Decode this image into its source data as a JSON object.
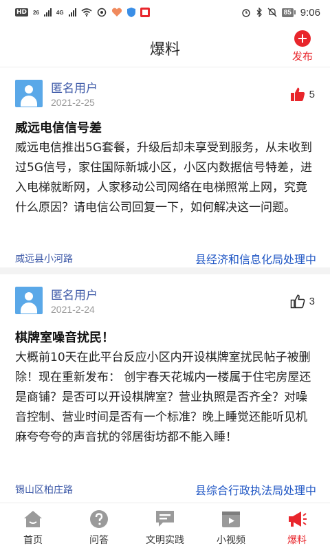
{
  "status_bar": {
    "hd": "HD",
    "sim1": "26",
    "sim2": "4G",
    "battery": "85",
    "time": "9:06"
  },
  "header": {
    "title": "爆料",
    "publish_label": "发布"
  },
  "posts": [
    {
      "user": "匿名用户",
      "date": "2021-2-25",
      "likes": "5",
      "liked": true,
      "title": "威远电信信号差",
      "body": "威远电信推出5G套餐，升级后却未享受到服务，从未收到过5G信号，家住国际新城小区，小区内数据信号特差，进入电梯就断网，人家移动公司网络在电梯照常上网，究竟什么原因？请电信公司回复一下，如何解决这一问题。",
      "location": "威远县小河路",
      "department": "县经济和信息化局处理中"
    },
    {
      "user": "匿名用户",
      "date": "2021-2-24",
      "likes": "3",
      "liked": false,
      "title": "棋牌室噪音扰民！",
      "body": "大概前10天在此平台反应小区内开设棋牌室扰民帖子被删除！现在重新发布： 创宇春天花城内一楼属于住宅房屋还是商铺？是否可以开设棋牌室？营业执照是否齐全？对噪音控制、营业时间是否有一个标准？晚上睡觉还能听见机麻夸夸夸的声音扰的邻居街坊都不能入睡！",
      "location": "锡山区柏庄路",
      "department": "县综合行政执法局处理中"
    }
  ],
  "tabs": [
    {
      "label": "首页",
      "icon": "home-icon"
    },
    {
      "label": "问答",
      "icon": "question-icon"
    },
    {
      "label": "文明实践",
      "icon": "chat-icon"
    },
    {
      "label": "小视频",
      "icon": "video-icon"
    },
    {
      "label": "爆料",
      "icon": "megaphone-icon",
      "active": true
    }
  ],
  "colors": {
    "accent": "#e8262c",
    "link": "#1f56c4",
    "username": "#3e5aa8",
    "avatar": "#5aa8e8"
  }
}
